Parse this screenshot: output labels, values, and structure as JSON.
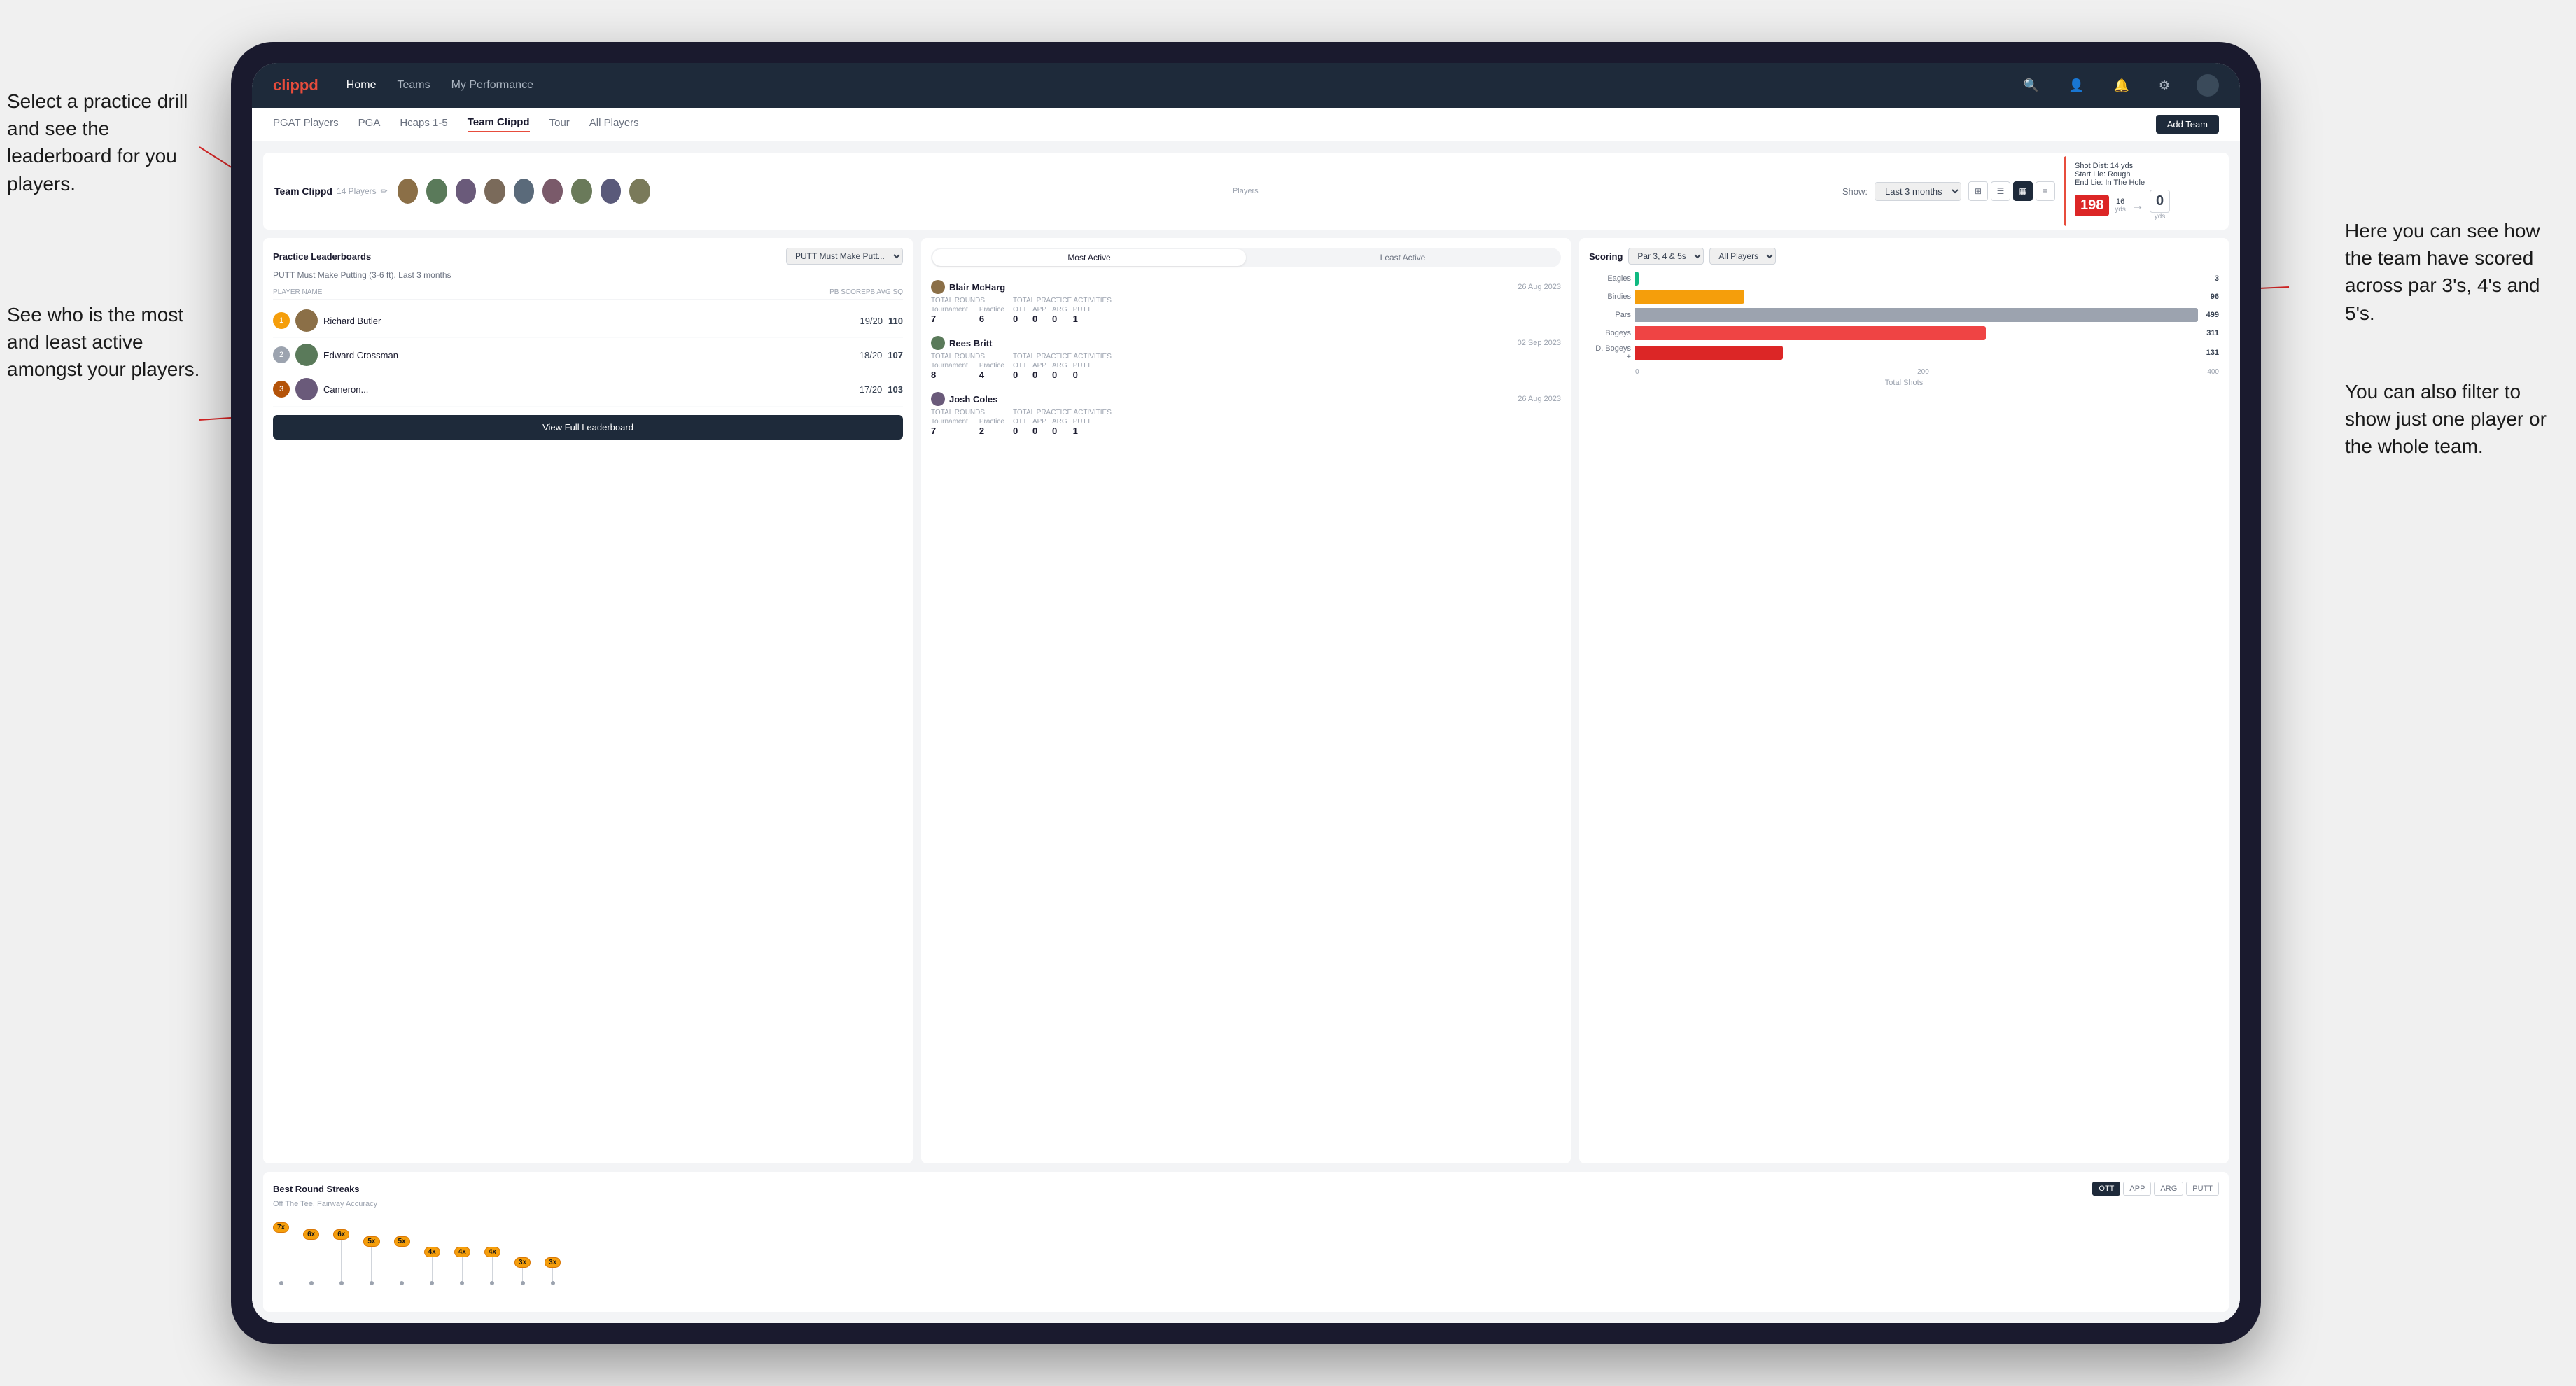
{
  "annotations": {
    "top_left": "Select a practice drill and see the leaderboard for you players.",
    "bottom_left": "See who is the most and least active amongst your players.",
    "top_right": "Here you can see how the team have scored across par 3's, 4's and 5's.",
    "bottom_right": "You can also filter to show just one player or the whole team."
  },
  "navbar": {
    "brand": "clippd",
    "links": [
      "Home",
      "Teams",
      "My Performance"
    ],
    "icons": [
      "search",
      "person",
      "bell",
      "settings",
      "avatar"
    ]
  },
  "subnav": {
    "links": [
      "PGAT Players",
      "PGA",
      "Hcaps 1-5",
      "Team Clippd",
      "Tour",
      "All Players"
    ],
    "active": "Team Clippd",
    "add_team_btn": "Add Team"
  },
  "team_header": {
    "title": "Team Clippd",
    "count": "14 Players",
    "show_label": "Show:",
    "show_value": "Last 3 months",
    "players_label": "Players"
  },
  "shot_card": {
    "shot_dist_label": "Shot Dist: 14 yds",
    "start_lie": "Start Lie: Rough",
    "end_lie": "End Lie: In The Hole",
    "num": "198",
    "dist_val": "16",
    "dist_yds": "yds",
    "end_val": "0",
    "end_yds": "yds"
  },
  "practice_leaderboard": {
    "title": "Practice Leaderboards",
    "select_label": "PUTT Must Make Putt...",
    "subtitle": "PUTT Must Make Putting (3-6 ft), Last 3 months",
    "col_player": "PLAYER NAME",
    "col_score": "PB SCORE",
    "col_avg": "PB AVG SQ",
    "players": [
      {
        "rank": 1,
        "rank_type": "gold",
        "name": "Richard Butler",
        "score": "19/20",
        "avg": "110",
        "badge": "1"
      },
      {
        "rank": 2,
        "rank_type": "silver",
        "name": "Edward Crossman",
        "score": "18/20",
        "avg": "107",
        "badge": "2"
      },
      {
        "rank": 3,
        "rank_type": "bronze",
        "name": "Cameron...",
        "score": "17/20",
        "avg": "103",
        "badge": "3"
      }
    ],
    "view_full_btn": "View Full Leaderboard"
  },
  "activity": {
    "toggle_most": "Most Active",
    "toggle_least": "Least Active",
    "active_tab": "most",
    "players": [
      {
        "name": "Blair McHarg",
        "date": "26 Aug 2023",
        "total_rounds_label": "Total Rounds",
        "tournament": "7",
        "practice": "6",
        "practice_label": "Practice",
        "total_practice_label": "Total Practice Activities",
        "ott": "0",
        "app": "0",
        "arg": "0",
        "putt": "1"
      },
      {
        "name": "Rees Britt",
        "date": "02 Sep 2023",
        "total_rounds_label": "Total Rounds",
        "tournament": "8",
        "practice": "4",
        "practice_label": "Practice",
        "total_practice_label": "Total Practice Activities",
        "ott": "0",
        "app": "0",
        "arg": "0",
        "putt": "0"
      },
      {
        "name": "Josh Coles",
        "date": "26 Aug 2023",
        "total_rounds_label": "Total Rounds",
        "tournament": "7",
        "practice": "2",
        "practice_label": "Practice",
        "total_practice_label": "Total Practice Activities",
        "ott": "0",
        "app": "0",
        "arg": "0",
        "putt": "1"
      }
    ]
  },
  "scoring": {
    "title": "Scoring",
    "filter1": "Par 3, 4 & 5s",
    "filter2": "All Players",
    "bars": [
      {
        "label": "Eagles",
        "value": 3,
        "max": 500,
        "type": "eagles",
        "color": "#10b981"
      },
      {
        "label": "Birdies",
        "value": 96,
        "max": 500,
        "type": "birdies",
        "color": "#f59e0b"
      },
      {
        "label": "Pars",
        "value": 499,
        "max": 500,
        "type": "pars",
        "color": "#9ca3af"
      },
      {
        "label": "Bogeys",
        "value": 311,
        "max": 500,
        "type": "bogeys",
        "color": "#ef4444"
      },
      {
        "label": "D. Bogeys +",
        "value": 131,
        "max": 500,
        "type": "dbogeys",
        "color": "#dc2626"
      }
    ],
    "x_labels": [
      "0",
      "200",
      "400"
    ],
    "x_title": "Total Shots"
  },
  "streaks": {
    "title": "Best Round Streaks",
    "tabs": [
      "OTT",
      "APP",
      "ARG",
      "PUTT"
    ],
    "active_tab": "OTT",
    "subtitle": "Off The Tee, Fairway Accuracy",
    "points": [
      {
        "badge": "7x",
        "height": 90
      },
      {
        "badge": "6x",
        "height": 80
      },
      {
        "badge": "6x",
        "height": 80
      },
      {
        "badge": "5x",
        "height": 70
      },
      {
        "badge": "5x",
        "height": 70
      },
      {
        "badge": "4x",
        "height": 55
      },
      {
        "badge": "4x",
        "height": 55
      },
      {
        "badge": "4x",
        "height": 55
      },
      {
        "badge": "3x",
        "height": 40
      },
      {
        "badge": "3x",
        "height": 40
      }
    ]
  }
}
